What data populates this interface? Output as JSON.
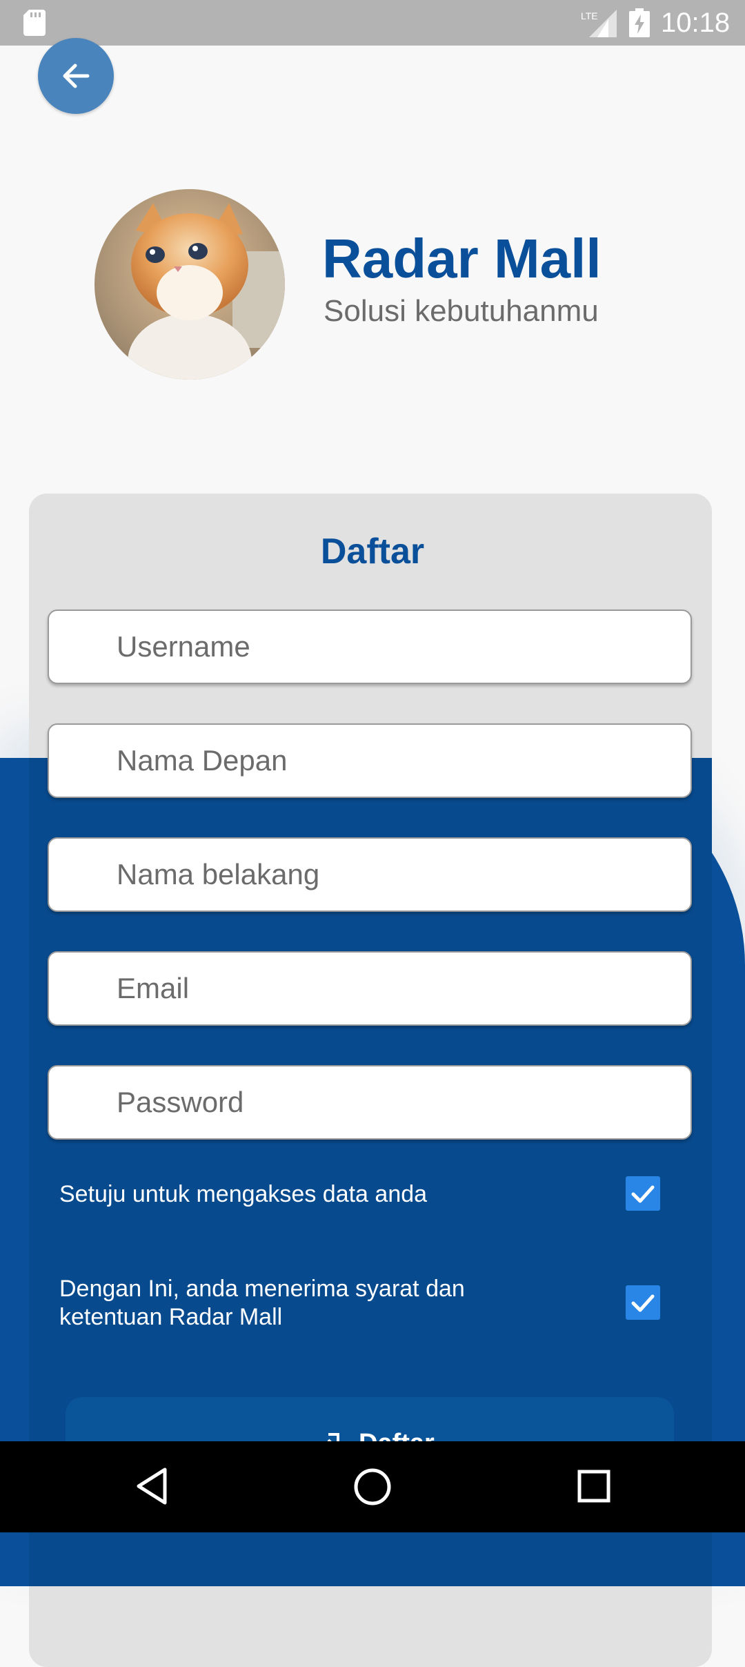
{
  "status_bar": {
    "time": "10:18",
    "network_label": "LTE"
  },
  "header": {
    "title": "Radar Mall",
    "subtitle": "Solusi kebutuhanmu"
  },
  "form": {
    "title": "Daftar",
    "fields": [
      {
        "name": "username",
        "placeholder": "Username",
        "value": ""
      },
      {
        "name": "first-name",
        "placeholder": "Nama Depan",
        "value": ""
      },
      {
        "name": "last-name",
        "placeholder": "Nama belakang",
        "value": ""
      },
      {
        "name": "email",
        "placeholder": "Email",
        "value": ""
      },
      {
        "name": "password",
        "placeholder": "Password",
        "value": ""
      }
    ],
    "checks": [
      {
        "label": "Setuju untuk mengakses data anda",
        "checked": true
      },
      {
        "label_line1": "Dengan Ini, anda menerima syarat dan",
        "label_line2": "ketentuan Radar Mall",
        "checked": true
      }
    ],
    "submit_label": "Daftar"
  },
  "colors": {
    "brand_blue": "#0a4f99",
    "checkbox_blue": "#2a86e6",
    "back_button": "#4a84bd"
  },
  "icons": [
    "sd-card-icon",
    "lte-signal-icon",
    "battery-charging-icon",
    "arrow-left-icon",
    "check-icon",
    "login-icon",
    "nav-back-icon",
    "nav-home-icon",
    "nav-recent-icon"
  ]
}
